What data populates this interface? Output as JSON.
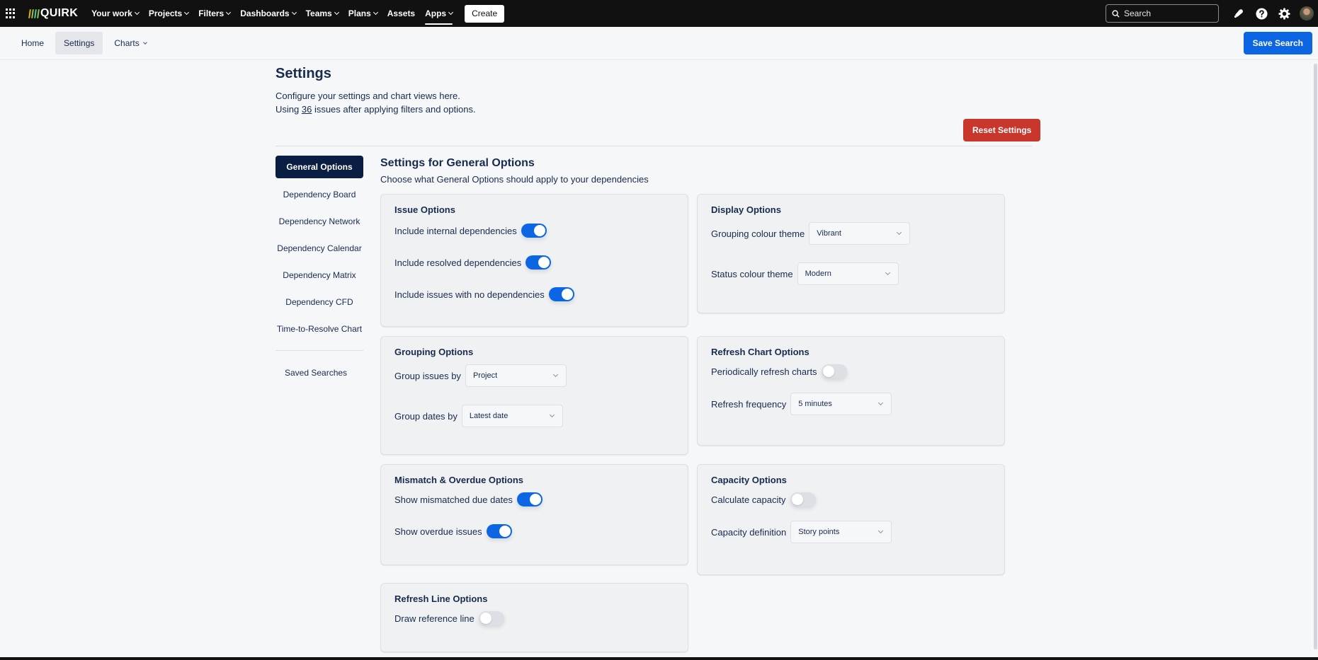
{
  "topnav": {
    "logo": "QUIRK",
    "logo_colors": [
      "#e2b203",
      "#94c748",
      "#4bce97",
      "#94c748"
    ],
    "items": [
      {
        "label": "Your work",
        "dropdown": true
      },
      {
        "label": "Projects",
        "dropdown": true
      },
      {
        "label": "Filters",
        "dropdown": true
      },
      {
        "label": "Dashboards",
        "dropdown": true
      },
      {
        "label": "Teams",
        "dropdown": true
      },
      {
        "label": "Plans",
        "dropdown": true
      },
      {
        "label": "Assets",
        "dropdown": false
      },
      {
        "label": "Apps",
        "dropdown": true,
        "active": true
      }
    ],
    "create_label": "Create",
    "search_placeholder": "Search",
    "icons": [
      "notifications-icon",
      "help-icon",
      "settings-icon",
      "avatar"
    ]
  },
  "subnav": {
    "items": [
      {
        "label": "Home"
      },
      {
        "label": "Settings",
        "selected": true
      },
      {
        "label": "Charts",
        "dropdown": true
      }
    ],
    "save_search_label": "Save Search"
  },
  "header": {
    "title": "Settings",
    "desc_line1": "Configure your settings and chart views here.",
    "desc_prefix": "Using ",
    "issue_count": "36",
    "desc_suffix": " issues after applying filters and options.",
    "reset_label": "Reset Settings"
  },
  "sidebar": {
    "items": [
      {
        "label": "General Options",
        "selected": true
      },
      {
        "label": "Dependency Board"
      },
      {
        "label": "Dependency Network"
      },
      {
        "label": "Dependency Calendar"
      },
      {
        "label": "Dependency Matrix"
      },
      {
        "label": "Dependency CFD"
      },
      {
        "label": "Time-to-Resolve Chart"
      }
    ],
    "saved_searches": "Saved Searches"
  },
  "content": {
    "title": "Settings for General Options",
    "subtitle": "Choose what General Options should apply to your dependencies",
    "issue_options": {
      "title": "Issue Options",
      "toggles": [
        {
          "label": "Include internal dependencies",
          "on": true
        },
        {
          "label": "Include resolved dependencies",
          "on": true
        },
        {
          "label": "Include issues with no dependencies",
          "on": true
        }
      ]
    },
    "display_options": {
      "title": "Display Options",
      "grouping_colour_label": "Grouping colour theme",
      "grouping_colour_value": "Vibrant",
      "status_colour_label": "Status colour theme",
      "status_colour_value": "Modern"
    },
    "grouping_options": {
      "title": "Grouping Options",
      "group_issues_label": "Group issues by",
      "group_issues_value": "Project",
      "group_dates_label": "Group dates by",
      "group_dates_value": "Latest date"
    },
    "refresh_chart_options": {
      "title": "Refresh Chart Options",
      "periodic_label": "Periodically refresh charts",
      "periodic_on": false,
      "frequency_label": "Refresh frequency",
      "frequency_value": "5 minutes"
    },
    "mismatch_options": {
      "title": "Mismatch & Overdue Options",
      "toggles": [
        {
          "label": "Show mismatched due dates",
          "on": true
        },
        {
          "label": "Show overdue issues",
          "on": true
        }
      ]
    },
    "capacity_options": {
      "title": "Capacity Options",
      "calculate_label": "Calculate capacity",
      "calculate_on": false,
      "definition_label": "Capacity definition",
      "definition_value": "Story points"
    },
    "refresh_line_options": {
      "title": "Refresh Line Options",
      "draw_label": "Draw reference line",
      "draw_on": false
    }
  }
}
